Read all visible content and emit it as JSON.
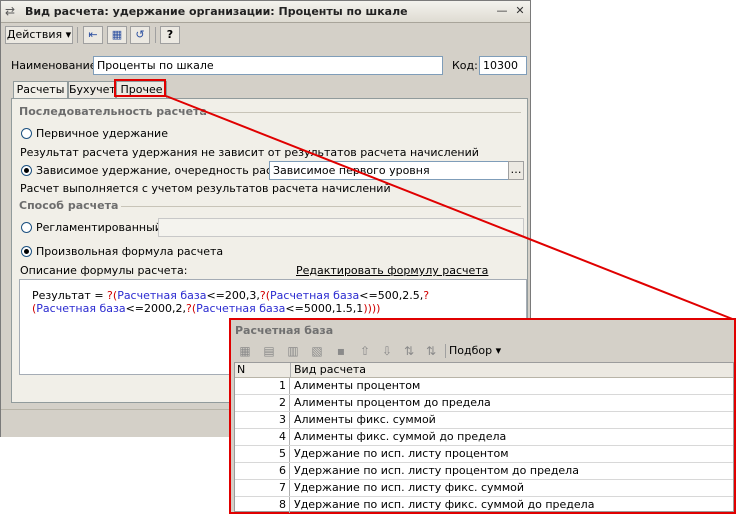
{
  "window": {
    "title": "Вид расчета: удержание организации: Проценты по шкале",
    "close_glyph": "✕",
    "menu_glyph": "—"
  },
  "toolbar": {
    "actions_label": "Действия",
    "help_label": "?"
  },
  "form": {
    "name_label": "Наименование:",
    "name_value": "Проценты по шкале",
    "code_label": "Код:",
    "code_value": "10300"
  },
  "tabs": [
    {
      "label": "Расчеты"
    },
    {
      "label": "Бухучет"
    },
    {
      "label": "Прочее"
    }
  ],
  "panel": {
    "sequence_title": "Последовательность расчета",
    "primary_label": "Первичное удержание",
    "primary_note": "Результат расчета удержания не зависит от результатов расчета начислений",
    "dependent_label": "Зависимое удержание, очередность расчета:",
    "dependent_value": "Зависимое первого уровня",
    "dependent_note": "Расчет выполняется с учетом результатов расчета начислений",
    "method_title": "Способ расчета",
    "regulated_label": "Регламентированный:",
    "custom_label": "Произвольная формула расчета",
    "formula_desc_label": "Описание формулы расчета:",
    "edit_formula_link": "Редактировать формулу расчета",
    "formula_parts": {
      "p1": "Результат = ",
      "p2": "?(",
      "p3": "Расчетная база",
      "p4": "<=200,3,",
      "p5": "?(",
      "p6": "Расчетная база",
      "p7": "<=500,2.5,",
      "p8": "?(",
      "p9": "Расчетная база",
      "p10": "<=2000,2,",
      "p11": "?(",
      "p12": "Расчетная база",
      "p13": "<=5000,1.5,1",
      "p14": "))))"
    }
  },
  "popup": {
    "title": "Расчетная база",
    "podbor_label": "Подбор",
    "columns": {
      "n": "N",
      "type": "Вид расчета"
    },
    "rows": [
      {
        "n": "1",
        "name": "Алименты процентом"
      },
      {
        "n": "2",
        "name": "Алименты процентом до предела"
      },
      {
        "n": "3",
        "name": "Алименты фикс. суммой"
      },
      {
        "n": "4",
        "name": "Алименты фикс. суммой до предела"
      },
      {
        "n": "5",
        "name": "Удержание по исп. листу процентом"
      },
      {
        "n": "6",
        "name": "Удержание по исп. листу процентом до предела"
      },
      {
        "n": "7",
        "name": "Удержание по исп. листу фикс. суммой"
      },
      {
        "n": "8",
        "name": "Удержание по исп. листу фикс. суммой до предела"
      }
    ]
  },
  "colors": {
    "highlight": "#e00000",
    "formula_blue": "#2a2ad0",
    "formula_red": "#d00000"
  }
}
